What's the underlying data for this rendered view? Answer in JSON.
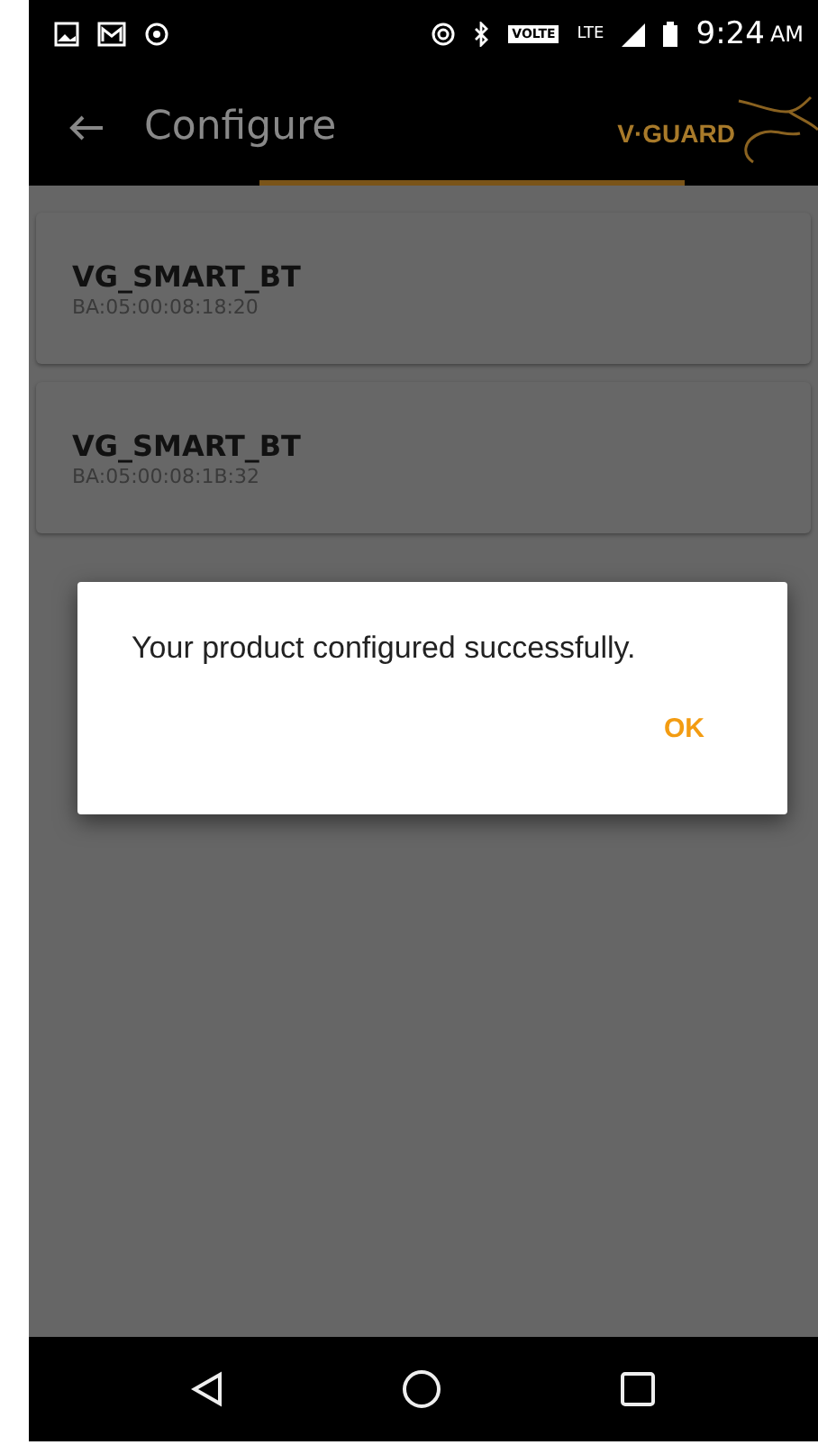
{
  "status_bar": {
    "time": "9:24",
    "ampm": "AM",
    "volte": "VOLTE",
    "network": "LTE"
  },
  "app_bar": {
    "title": "Configure",
    "logo": "V·GUARD"
  },
  "devices": [
    {
      "name": "VG_SMART_BT",
      "address": "BA:05:00:08:18:20"
    },
    {
      "name": "VG_SMART_BT",
      "address": "BA:05:00:08:1B:32"
    }
  ],
  "dialog": {
    "message": "Your product configured successfully.",
    "button": "OK"
  }
}
